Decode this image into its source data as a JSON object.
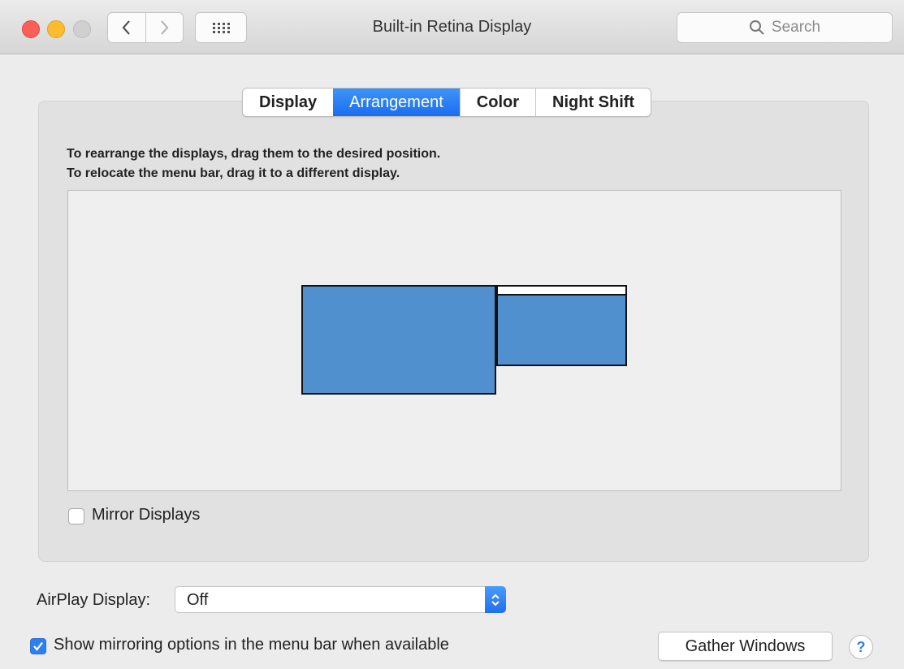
{
  "window": {
    "title": "Built-in Retina Display",
    "search_placeholder": "Search"
  },
  "tabs": [
    {
      "label": "Display",
      "active": false
    },
    {
      "label": "Arrangement",
      "active": true
    },
    {
      "label": "Color",
      "active": false
    },
    {
      "label": "Night Shift",
      "active": false
    }
  ],
  "arrangement": {
    "instruction_line1": "To rearrange the displays, drag them to the desired position.",
    "instruction_line2": "To relocate the menu bar, drag it to a different display.",
    "display_color": "#5090cf"
  },
  "mirror": {
    "label": "Mirror Displays",
    "checked": false
  },
  "airplay": {
    "label": "AirPlay Display:",
    "value": "Off"
  },
  "show_mirroring": {
    "label": "Show mirroring options in the menu bar when available",
    "checked": true
  },
  "buttons": {
    "gather": "Gather Windows",
    "help": "?"
  },
  "colors": {
    "accent": "#2f7fef",
    "close": "#fc5f57",
    "minimize": "#fdbc2e",
    "zoom_disabled": "#d0d0d0"
  }
}
